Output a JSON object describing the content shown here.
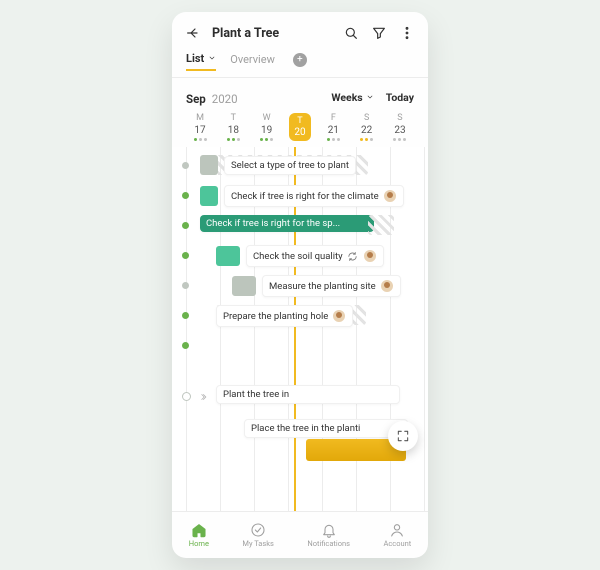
{
  "header": {
    "title": "Plant a Tree"
  },
  "tabs": {
    "list": "List",
    "overview": "Overview"
  },
  "date": {
    "month": "Sep",
    "year": "2020",
    "weeks_label": "Weeks",
    "today_label": "Today"
  },
  "week": [
    {
      "d": "M",
      "n": "17"
    },
    {
      "d": "T",
      "n": "18"
    },
    {
      "d": "W",
      "n": "19"
    },
    {
      "d": "T",
      "n": "20"
    },
    {
      "d": "F",
      "n": "21"
    },
    {
      "d": "S",
      "n": "22"
    },
    {
      "d": "S",
      "n": "23"
    }
  ],
  "tasks": {
    "t1": "Select a type of tree to plant",
    "t2": "Check if tree is right for the climate",
    "t3": "Check if tree is right for the sp...",
    "t4": "Check the soil quality",
    "t5": "Measure the planting site",
    "t6": "Prepare the planting hole",
    "t7": "Plant the tree in",
    "t8": "Place the tree in the planti"
  },
  "nav": {
    "home": "Home",
    "mytasks": "My Tasks",
    "notifications": "Notifications",
    "account": "Account"
  }
}
